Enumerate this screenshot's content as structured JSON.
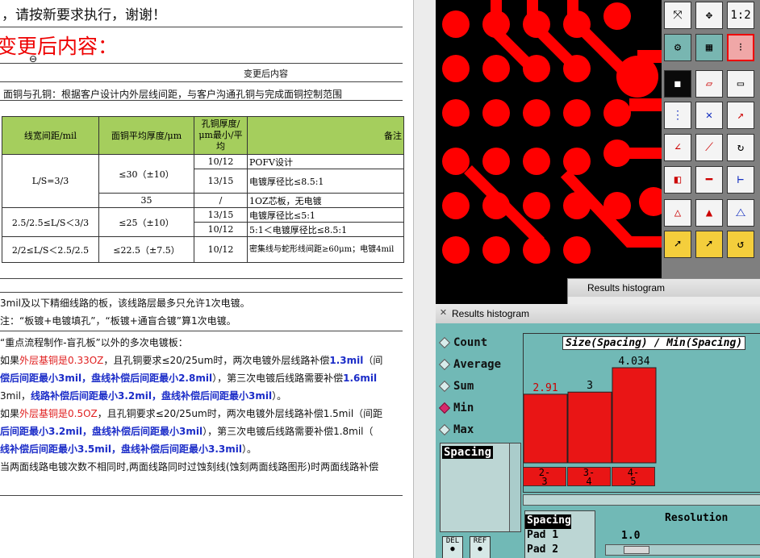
{
  "document": {
    "notice_line": "，请按新要求执行，谢谢！",
    "section_title": "变更后内容：",
    "table_caption": "变更后内容",
    "copper_line": "面铜与孔铜：根据客户设计内外层线间距，与客户沟通孔铜与完成面铜控制范围",
    "table": {
      "headers": [
        "线宽间距/mil",
        "面铜平均厚度/μm",
        "孔铜厚度/μm最小/平均",
        "备注"
      ],
      "rows": [
        [
          "L/S=3/3",
          "≤30（±10）",
          "10/12",
          "POFV设计"
        ],
        [
          "",
          "",
          "13/15",
          "电镀厚径比≤8.5:1"
        ],
        [
          "",
          "35",
          "/",
          "1OZ芯板，无电镀"
        ],
        [
          "2.5/2.5≤L/S＜3/3",
          "≤25（±10）",
          "13/15",
          "电镀厚径比≤5:1"
        ],
        [
          "",
          "",
          "10/12",
          "5:1＜电镀厚径比≤8.5:1"
        ],
        [
          "2/2≤L/S＜2.5/2.5",
          "≤22.5（±7.5）",
          "10/12",
          "密集线与蛇形线间距≥60μm；电镀4mil"
        ]
      ]
    },
    "para1": "3mil及以下精细线路的板，该线路层最多只允许1次电镀。",
    "para2": "注：“板镀+电镀填孔”，“板镀+通盲合镀”算1次电镀。",
    "para3": "“重点流程制作-盲孔板”以外的多次电镀板：",
    "p4a": "如果",
    "p4b": "外层基铜是0.33OZ",
    "p4c": "，且孔铜要求≤20/25um时，两次电镀外层线路补偿",
    "p4d": "1.3mil",
    "p4e": "（间",
    "p5a": "偿后间距最小3mil，盘线补偿后间距最小2.8mil",
    "p5b": "），第三次电镀后线路需要补偿",
    "p5c": "1.6mil",
    "p6a": "3mil，",
    "p6b": "线路补偿后间距最小3.2mil，盘线补偿后间距最小3mil",
    "p6c": "）。",
    "p7a": "如果",
    "p7b": "外层基铜是0.5OZ",
    "p7c": "，且孔铜要求≤20/25um时，两次电镀外层线路补偿1.5mil（间距",
    "p8a": "后间距最小3.2mil，盘线补偿后间距最小3mil",
    "p8b": "），第三次电镀后线路需要补偿1.8mil（",
    "p9a": "线补偿后间距最小3.5mil，盘线补偿后间距最小3.3mil",
    "p9b": "）。",
    "p10": "当两面线路电镀次数不相同时,两面线路同时过蚀刻线(蚀刻两面线路图形)时两面线路补偿"
  },
  "cam": {
    "toolbar_zoom_label": "1:2",
    "back_window_title": "Results histogram",
    "window_title": "Results histogram",
    "radio_options": [
      "Count",
      "Average",
      "Sum",
      "Min",
      "Max"
    ],
    "selected_option": "Min",
    "list_item": "Spacing",
    "chart_title": "Size(Spacing) / Min(Spacing)",
    "bottom_list": [
      "Spacing",
      "Pad 1",
      "Pad 2"
    ],
    "resolution_label": "Resolution",
    "resolution_value": "1.0",
    "button_del": "DEL",
    "button_ref": "REF",
    "colors": {
      "pad_red": "#ff0000",
      "teal_panel": "#71b9b6",
      "bar_red": "#e91515"
    }
  },
  "chart_data": {
    "type": "bar",
    "title": "Size(Spacing) / Min(Spacing)",
    "categories": [
      "2-3",
      "3-4",
      "4-5"
    ],
    "values": [
      2.91,
      3,
      4.034
    ],
    "value_labels": [
      "2.91",
      "3",
      "4.034"
    ],
    "ylim": [
      0,
      4.034
    ],
    "grid": false
  }
}
